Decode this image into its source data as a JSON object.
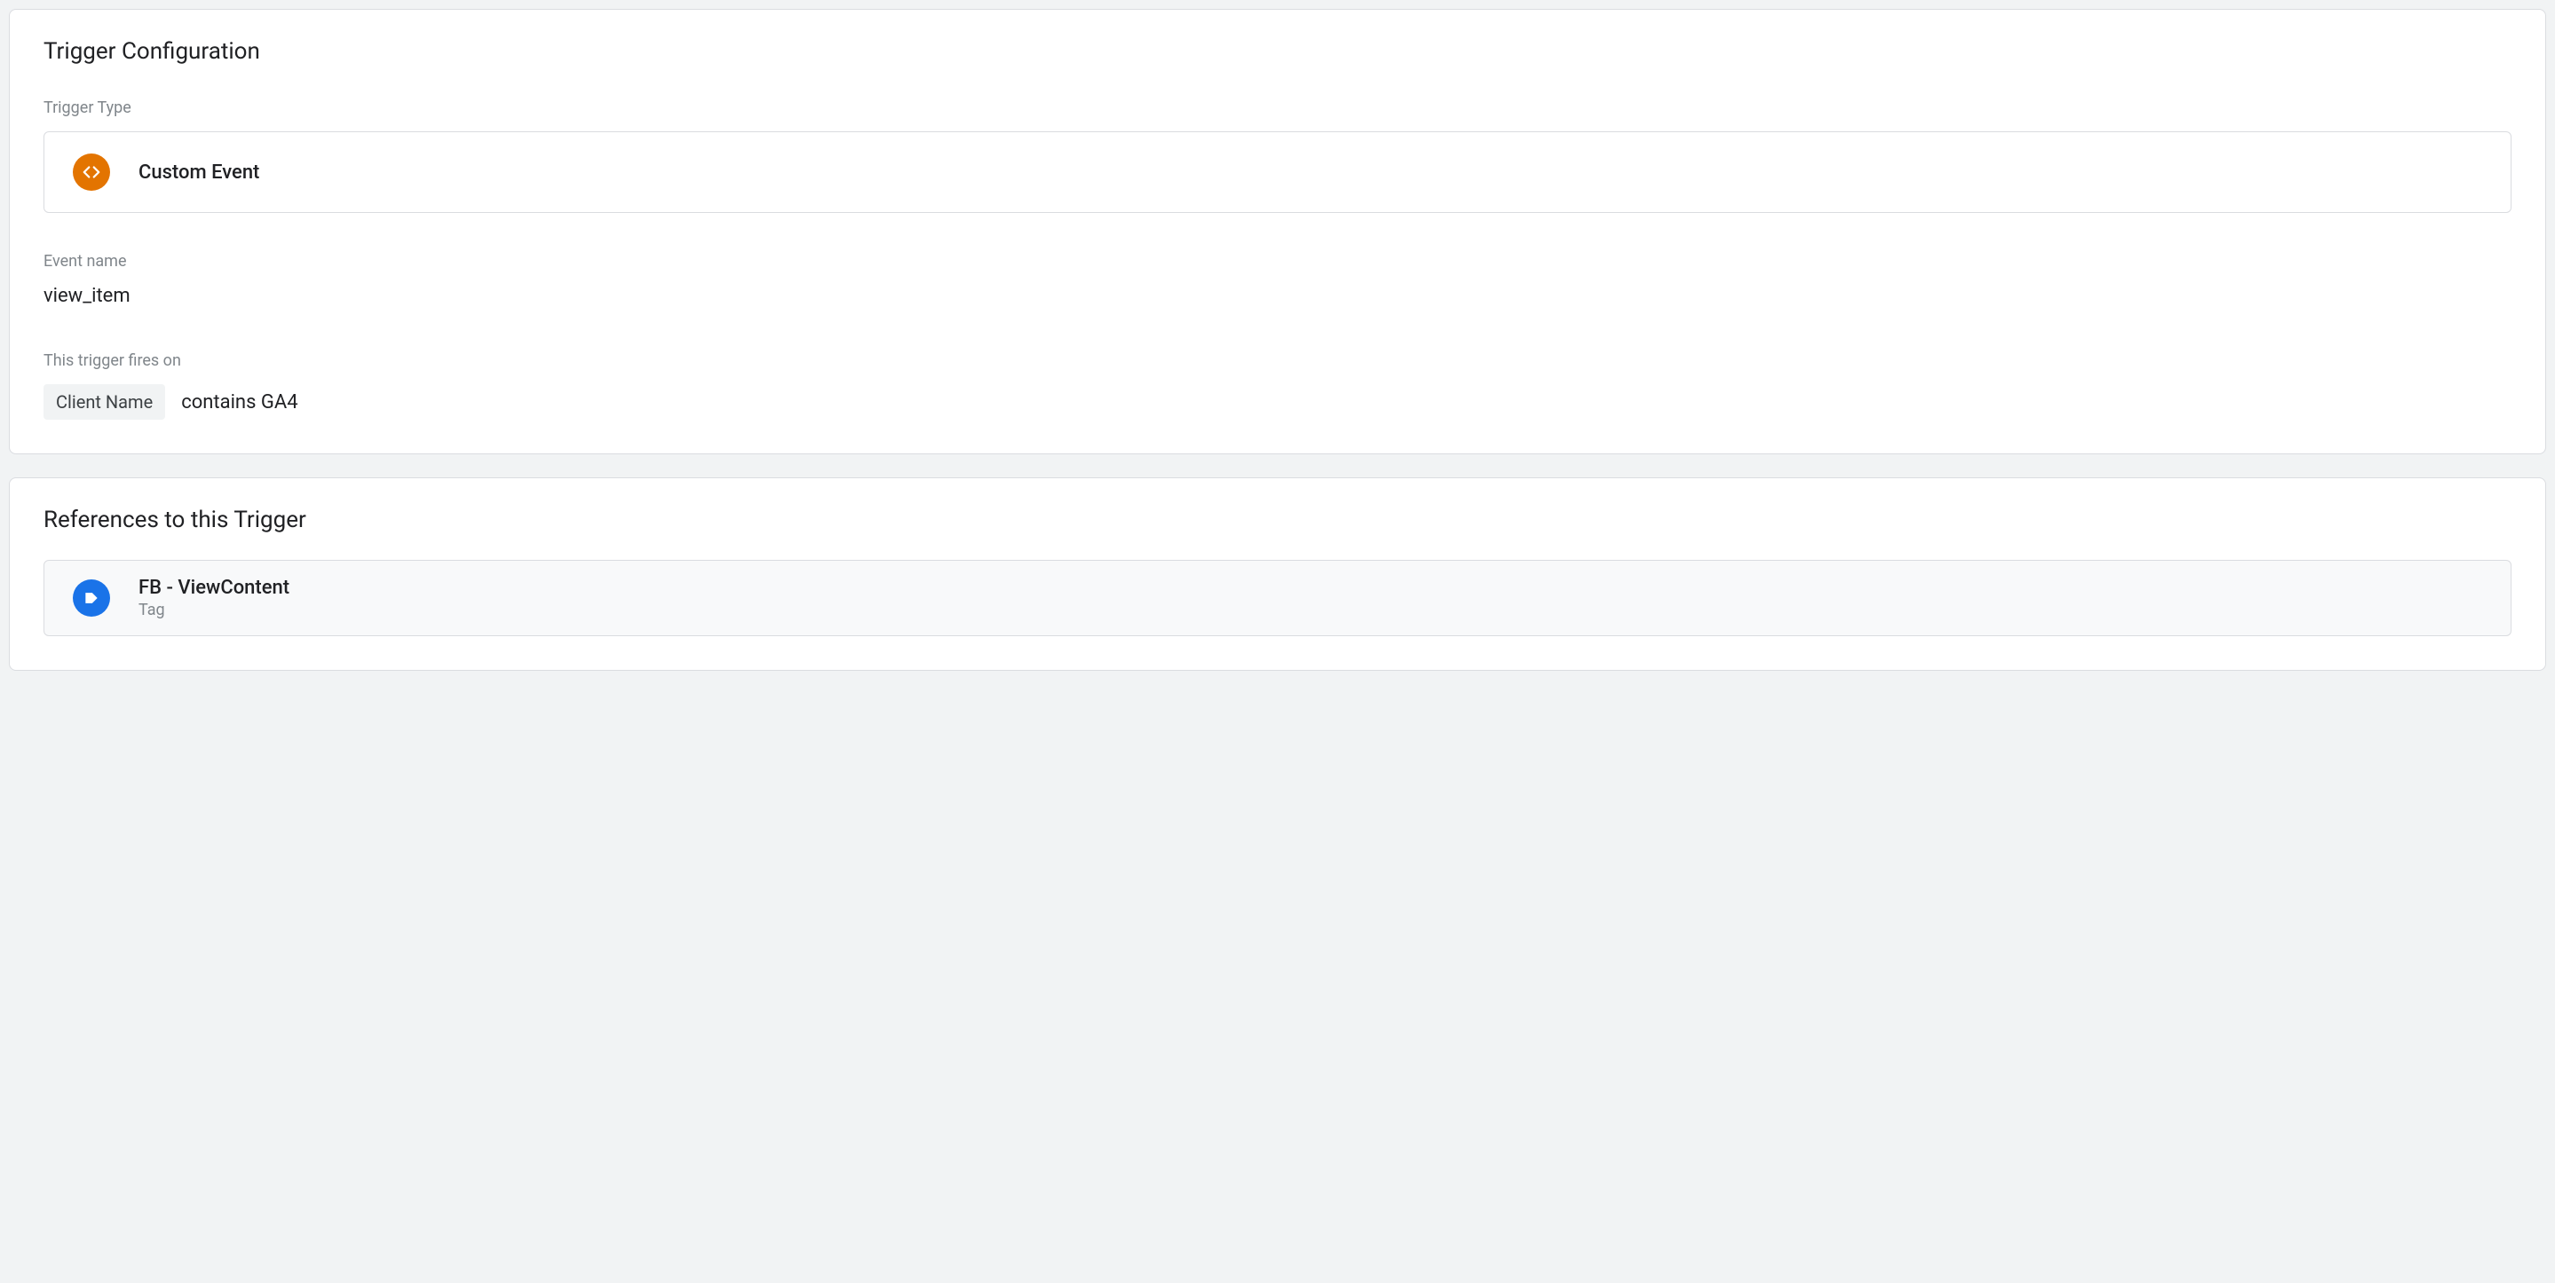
{
  "trigger_config": {
    "title": "Trigger Configuration",
    "trigger_type_label": "Trigger Type",
    "trigger_type_value": "Custom Event",
    "event_name_label": "Event name",
    "event_name_value": "view_item",
    "fires_on_label": "This trigger fires on",
    "fires_on_chip": "Client Name",
    "fires_on_rest": "contains GA4"
  },
  "references": {
    "title": "References to this Trigger",
    "items": [
      {
        "name": "FB - ViewContent",
        "type": "Tag"
      }
    ]
  },
  "colors": {
    "orange": "#e37400",
    "blue": "#1a73e8",
    "grey_bg": "#f1f3f4",
    "border": "#dadce0",
    "label": "#80868b"
  }
}
